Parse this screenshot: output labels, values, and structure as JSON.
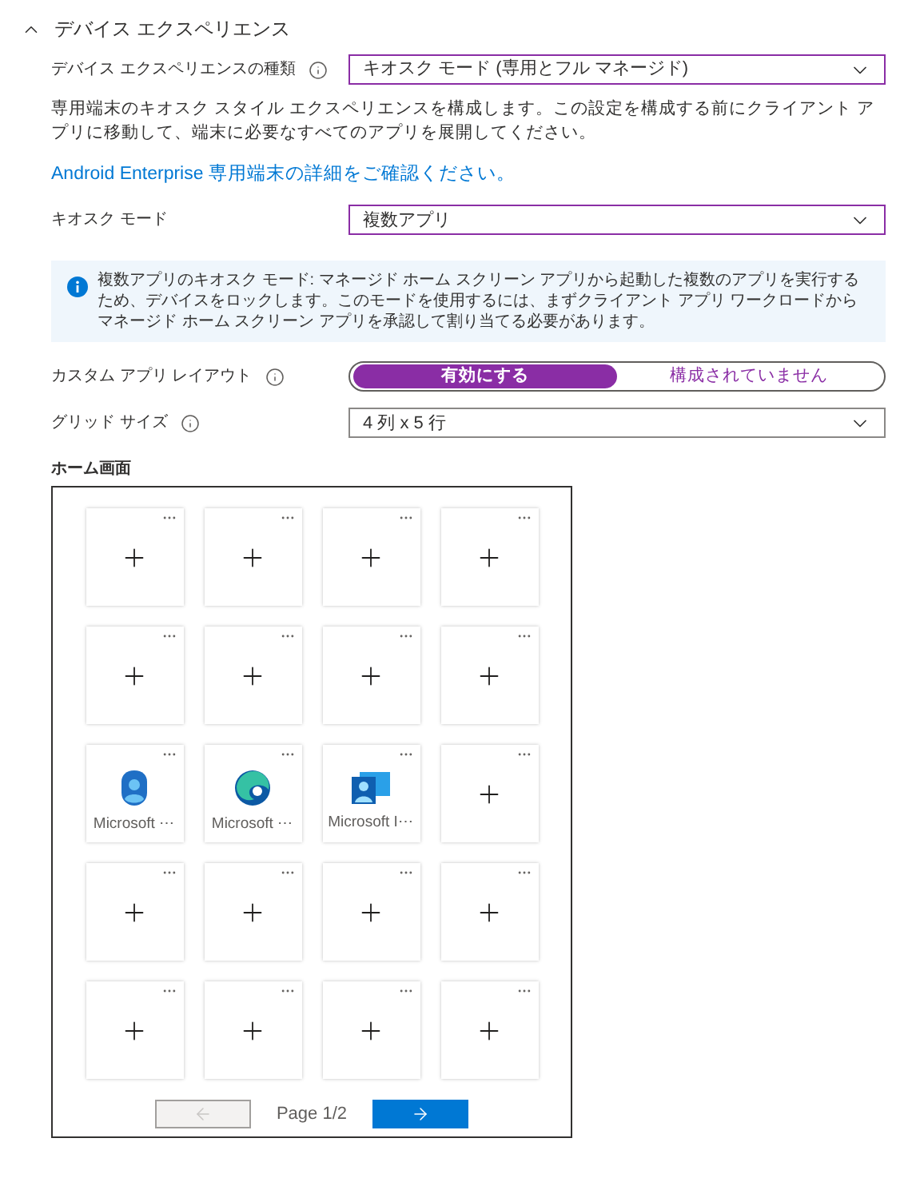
{
  "section": {
    "title": "デバイス エクスペリエンス",
    "expanded": true
  },
  "experience_type": {
    "label": "デバイス エクスペリエンスの種類",
    "value": "キオスク モード (専用とフル マネージド)"
  },
  "description": "専用端末のキオスク スタイル エクスペリエンスを構成します。この設定を構成する前にクライアント アプリに移動して、端末に必要なすべてのアプリを展開してください。",
  "learn_more_link": "Android Enterprise 専用端末の詳細をご確認ください。",
  "kiosk_mode": {
    "label": "キオスク モード",
    "value": "複数アプリ"
  },
  "info_banner": "複数アプリのキオスク モード: マネージド ホーム スクリーン アプリから起動した複数のアプリを実行するため、デバイスをロックします。このモードを使用するには、まずクライアント アプリ ワークロードからマネージド ホーム スクリーン アプリを承認して割り当てる必要があります。",
  "custom_layout": {
    "label": "カスタム アプリ レイアウト",
    "options": [
      {
        "label": "有効にする",
        "selected": true
      },
      {
        "label": "構成されていません",
        "selected": false
      }
    ]
  },
  "grid_size": {
    "label": "グリッド サイズ",
    "value": "4 列 x 5 行"
  },
  "home_screen": {
    "title": "ホーム画面",
    "tiles": [
      {
        "kind": "empty"
      },
      {
        "kind": "empty"
      },
      {
        "kind": "empty"
      },
      {
        "kind": "empty"
      },
      {
        "kind": "empty"
      },
      {
        "kind": "empty"
      },
      {
        "kind": "empty"
      },
      {
        "kind": "empty"
      },
      {
        "kind": "app",
        "label": "Microsoft ⋯"
      },
      {
        "kind": "app",
        "label": "Microsoft ⋯"
      },
      {
        "kind": "app",
        "label": "Microsoft I⋯"
      },
      {
        "kind": "empty"
      },
      {
        "kind": "empty"
      },
      {
        "kind": "empty"
      },
      {
        "kind": "empty"
      },
      {
        "kind": "empty"
      },
      {
        "kind": "empty"
      },
      {
        "kind": "empty"
      },
      {
        "kind": "empty"
      },
      {
        "kind": "empty"
      }
    ],
    "pagination": {
      "previous_disabled": true,
      "page": "Page 1/2",
      "next_disabled": false
    }
  }
}
